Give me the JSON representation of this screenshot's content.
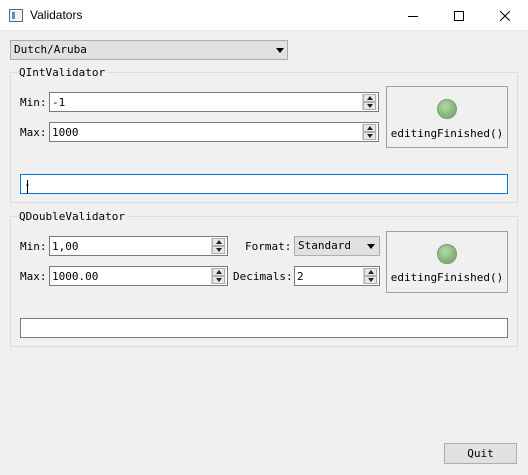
{
  "window": {
    "title": "Validators"
  },
  "locale_combo": {
    "value": "Dutch/Aruba"
  },
  "int_group": {
    "title": "QIntValidator",
    "min_label": "Min:",
    "min_value": "-1",
    "max_label": "Max:",
    "max_value": "1000",
    "signal_label": "editingFinished()",
    "edit_value": "-"
  },
  "double_group": {
    "title": "QDoubleValidator",
    "min_label": "Min:",
    "min_value": "1,00",
    "max_label": "Max:",
    "max_value": "1000.00",
    "format_label": "Format:",
    "format_value": "Standard",
    "decimals_label": "Decimals:",
    "decimals_value": "2",
    "signal_label": "editingFinished()",
    "edit_value": ""
  },
  "footer": {
    "quit_label": "Quit"
  },
  "colors": {
    "led": "#8fbf84",
    "focus_border": "#0078d7",
    "titlebar": "#ffffff"
  },
  "icons": [
    "app-icon",
    "minimize-icon",
    "maximize-icon",
    "close-icon",
    "dropdown-arrow-icon",
    "spin-up-icon",
    "spin-down-icon",
    "led-indicator"
  ]
}
